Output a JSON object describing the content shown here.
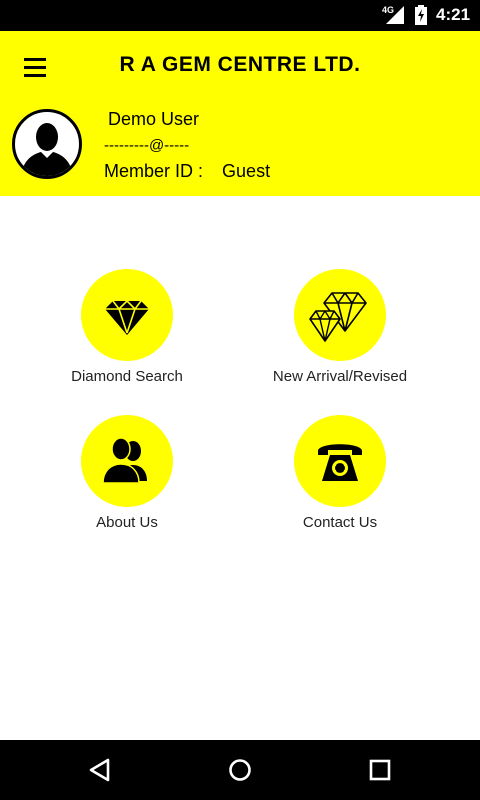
{
  "status_bar": {
    "network": "4G",
    "time": "4:21"
  },
  "header": {
    "title": "R A GEM CENTRE LTD.",
    "menu_icon": "hamburger-menu-icon",
    "background_color": "#ffff00"
  },
  "profile": {
    "avatar_icon": "user-silhouette-icon",
    "name": "Demo User",
    "email": "---------@-----",
    "member_label": "Member ID :",
    "member_value": "Guest"
  },
  "menu_tiles": [
    {
      "label": "Diamond Search",
      "icon": "diamond-icon"
    },
    {
      "label": "New Arrival/Revised",
      "icon": "diamonds-icon"
    },
    {
      "label": "About Us",
      "icon": "users-icon"
    },
    {
      "label": "Contact Us",
      "icon": "telephone-icon"
    }
  ],
  "nav_bar": {
    "back_icon": "back-icon",
    "home_icon": "home-icon",
    "recents_icon": "recents-icon"
  }
}
